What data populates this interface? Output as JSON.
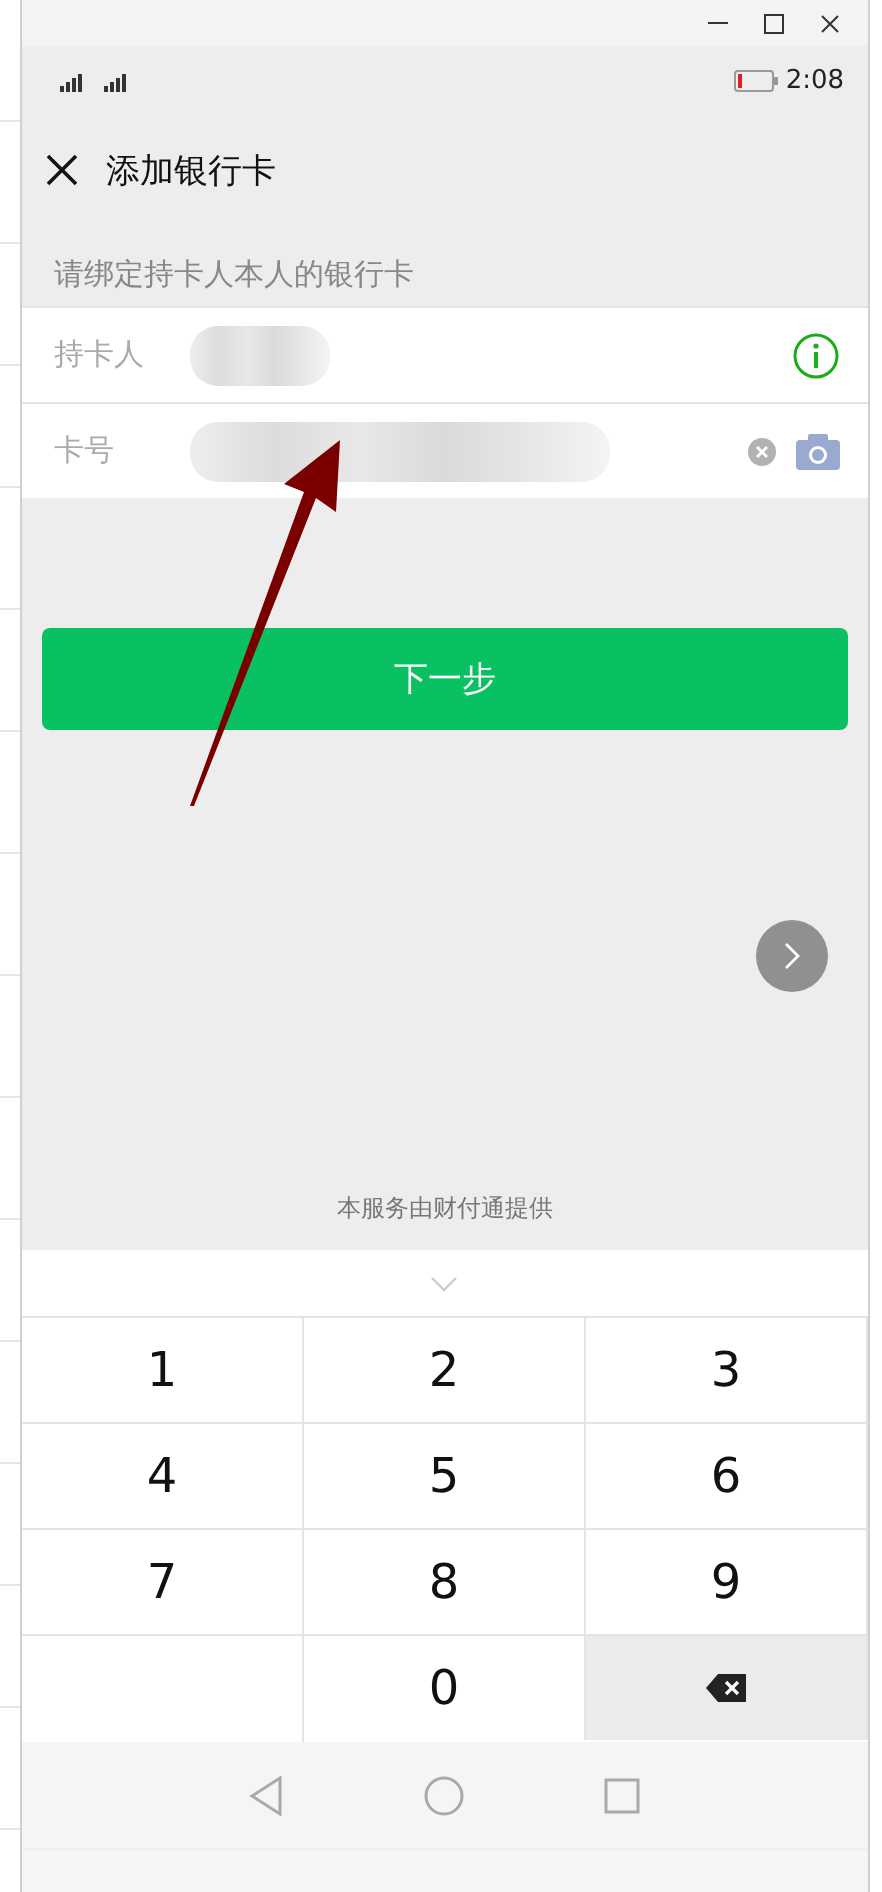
{
  "status_bar": {
    "time": "2:08"
  },
  "header": {
    "title": "添加银行卡"
  },
  "hint": "请绑定持卡人本人的银行卡",
  "fields": [
    {
      "kind": "holder",
      "label": "持卡人"
    },
    {
      "kind": "card",
      "label": "卡号"
    }
  ],
  "next_button": {
    "label": "下一步"
  },
  "footer": "本服务由财付通提供",
  "keypad": [
    {
      "kind": "digit",
      "label": "1"
    },
    {
      "kind": "digit",
      "label": "2"
    },
    {
      "kind": "digit",
      "label": "3"
    },
    {
      "kind": "digit",
      "label": "4"
    },
    {
      "kind": "digit",
      "label": "5"
    },
    {
      "kind": "digit",
      "label": "6"
    },
    {
      "kind": "digit",
      "label": "7"
    },
    {
      "kind": "digit",
      "label": "8"
    },
    {
      "kind": "digit",
      "label": "9"
    },
    {
      "kind": "blank"
    },
    {
      "kind": "digit",
      "label": "0"
    },
    {
      "kind": "backspace"
    }
  ]
}
